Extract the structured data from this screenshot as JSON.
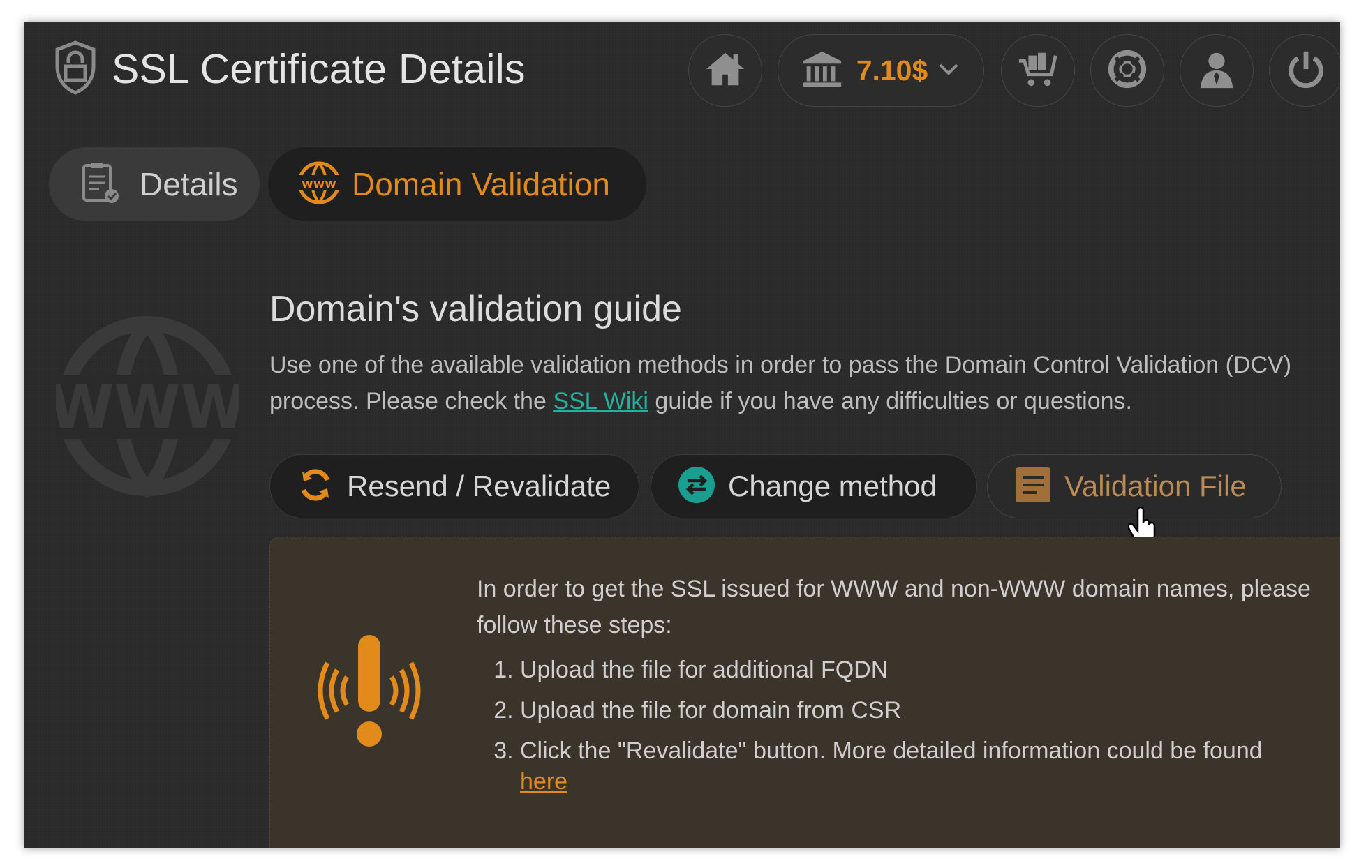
{
  "header": {
    "title": "SSL Certificate Details",
    "balance": "7.10$",
    "accent_color": "#e28a1a",
    "icons": [
      "shield-lock-icon",
      "home-icon",
      "bank-icon",
      "chevron-down-icon",
      "cart-icon",
      "lifebuoy-icon",
      "user-icon",
      "power-icon"
    ]
  },
  "tabs": [
    {
      "label": "Details",
      "icon": "clipboard-check-icon",
      "active": false
    },
    {
      "label": "Domain Validation",
      "icon": "www-globe-icon",
      "active": true
    }
  ],
  "guide": {
    "title": "Domain's validation guide",
    "text_before": "Use one of the available validation methods in order to pass the Domain Control Validation (DCV) process. Please check the ",
    "link_text": "SSL Wiki",
    "text_after": " guide if you have any difficulties or questions.",
    "link_color": "#20b3a2"
  },
  "actions": {
    "resend_label": "Resend / Revalidate",
    "change_label": "Change method",
    "file_label": "Validation File"
  },
  "notice": {
    "intro": "In order to get the SSL issued for WWW and non-WWW domain names, please follow these steps:",
    "steps": [
      "Upload the file for additional FQDN",
      "Upload the file for domain from CSR",
      "Click the \"Revalidate\" button. More detailed information could be found"
    ],
    "link_text": "here",
    "panel_color": "#3b342b"
  }
}
